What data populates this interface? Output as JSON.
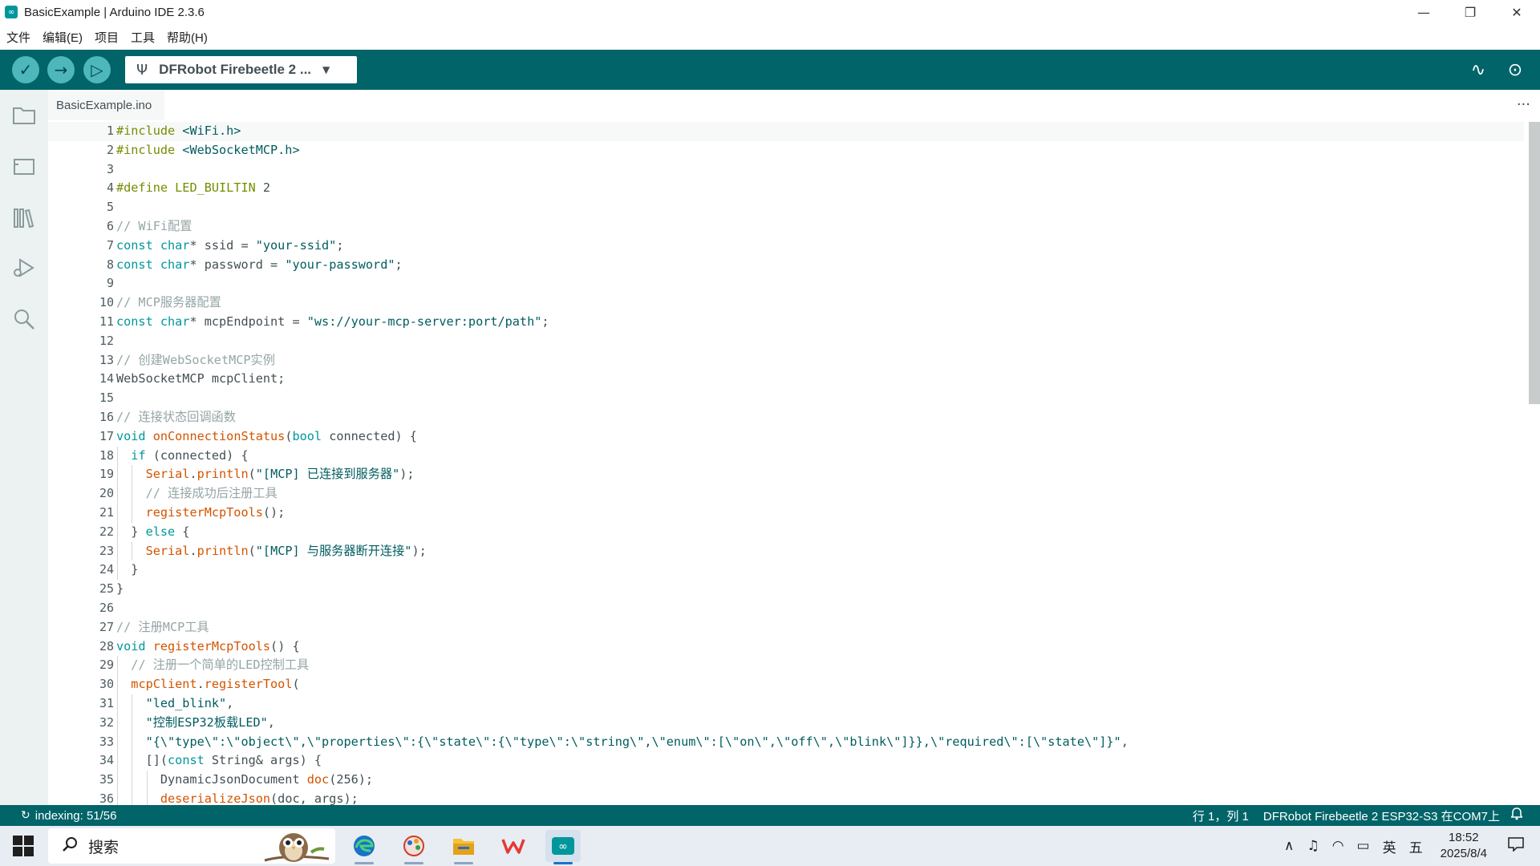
{
  "window": {
    "title": "BasicExample | Arduino IDE 2.3.6",
    "minimize": "—",
    "maximize": "❐",
    "close": "✕"
  },
  "menu": [
    "文件",
    "编辑(E)",
    "项目",
    "工具",
    "帮助(H)"
  ],
  "toolbar": {
    "verify_icon": "✓",
    "upload_icon": "→",
    "debug_icon": "▷",
    "board": "DFRobot Firebeetle 2 ...",
    "board_caret": "▼",
    "usb_icon": "Ψ",
    "plotter_icon": "∿",
    "monitor_icon": "⊙"
  },
  "sidebar_icons": [
    "folder-icon",
    "board-icon",
    "library-icon",
    "debug-icon",
    "search-icon"
  ],
  "tab": {
    "filename": "BasicExample.ino",
    "more": "···"
  },
  "colors": {
    "keyword": "#00979c",
    "type": "#00979c",
    "function": "#d35400",
    "string": "#005c5f",
    "comment": "#95a5a6",
    "directive": "#728e00",
    "plain": "#434f54",
    "toolbar": "#006468"
  },
  "code_lines": [
    {
      "n": "1",
      "indent": 0,
      "tokens": [
        [
          "#include",
          "directive"
        ],
        [
          " <WiFi.h>",
          "string"
        ]
      ]
    },
    {
      "n": "2",
      "indent": 0,
      "tokens": [
        [
          "#include",
          "directive"
        ],
        [
          " <WebSocketMCP.h>",
          "string"
        ]
      ]
    },
    {
      "n": "3",
      "indent": 0,
      "tokens": []
    },
    {
      "n": "4",
      "indent": 0,
      "tokens": [
        [
          "#define",
          "directive"
        ],
        [
          " LED_BUILTIN ",
          "directive"
        ],
        [
          "2",
          "plain"
        ]
      ]
    },
    {
      "n": "5",
      "indent": 0,
      "tokens": []
    },
    {
      "n": "6",
      "indent": 0,
      "tokens": [
        [
          "// WiFi配置",
          "comment"
        ]
      ]
    },
    {
      "n": "7",
      "indent": 0,
      "tokens": [
        [
          "const",
          "keyword"
        ],
        [
          " ",
          "plain"
        ],
        [
          "char",
          "type"
        ],
        [
          "* ssid = ",
          "plain"
        ],
        [
          "\"your-ssid\"",
          "string"
        ],
        [
          ";",
          "plain"
        ]
      ]
    },
    {
      "n": "8",
      "indent": 0,
      "tokens": [
        [
          "const",
          "keyword"
        ],
        [
          " ",
          "plain"
        ],
        [
          "char",
          "type"
        ],
        [
          "* password = ",
          "plain"
        ],
        [
          "\"your-password\"",
          "string"
        ],
        [
          ";",
          "plain"
        ]
      ]
    },
    {
      "n": "9",
      "indent": 0,
      "tokens": []
    },
    {
      "n": "10",
      "indent": 0,
      "tokens": [
        [
          "// MCP服务器配置",
          "comment"
        ]
      ]
    },
    {
      "n": "11",
      "indent": 0,
      "tokens": [
        [
          "const",
          "keyword"
        ],
        [
          " ",
          "plain"
        ],
        [
          "char",
          "type"
        ],
        [
          "* mcpEndpoint = ",
          "plain"
        ],
        [
          "\"ws://your-mcp-server:port/path\"",
          "string"
        ],
        [
          ";",
          "plain"
        ]
      ]
    },
    {
      "n": "12",
      "indent": 0,
      "tokens": []
    },
    {
      "n": "13",
      "indent": 0,
      "tokens": [
        [
          "// 创建WebSocketMCP实例",
          "comment"
        ]
      ]
    },
    {
      "n": "14",
      "indent": 0,
      "tokens": [
        [
          "WebSocketMCP mcpClient;",
          "plain"
        ]
      ]
    },
    {
      "n": "15",
      "indent": 0,
      "tokens": []
    },
    {
      "n": "16",
      "indent": 0,
      "tokens": [
        [
          "// 连接状态回调函数",
          "comment"
        ]
      ]
    },
    {
      "n": "17",
      "indent": 0,
      "tokens": [
        [
          "void",
          "keyword"
        ],
        [
          " ",
          "plain"
        ],
        [
          "onConnectionStatus",
          "function"
        ],
        [
          "(",
          "plain"
        ],
        [
          "bool",
          "type"
        ],
        [
          " connected) {",
          "plain"
        ]
      ]
    },
    {
      "n": "18",
      "indent": 1,
      "tokens": [
        [
          "  ",
          "plain"
        ],
        [
          "if",
          "keyword"
        ],
        [
          " (connected) {",
          "plain"
        ]
      ]
    },
    {
      "n": "19",
      "indent": 2,
      "tokens": [
        [
          "    ",
          "plain"
        ],
        [
          "Serial",
          "function"
        ],
        [
          ".",
          "plain"
        ],
        [
          "println",
          "function"
        ],
        [
          "(",
          "plain"
        ],
        [
          "\"[MCP] 已连接到服务器\"",
          "string"
        ],
        [
          ");",
          "plain"
        ]
      ]
    },
    {
      "n": "20",
      "indent": 2,
      "tokens": [
        [
          "    ",
          "plain"
        ],
        [
          "// 连接成功后注册工具",
          "comment"
        ]
      ]
    },
    {
      "n": "21",
      "indent": 2,
      "tokens": [
        [
          "    ",
          "plain"
        ],
        [
          "registerMcpTools",
          "function"
        ],
        [
          "();",
          "plain"
        ]
      ]
    },
    {
      "n": "22",
      "indent": 1,
      "tokens": [
        [
          "  } ",
          "plain"
        ],
        [
          "else",
          "keyword"
        ],
        [
          " {",
          "plain"
        ]
      ]
    },
    {
      "n": "23",
      "indent": 2,
      "tokens": [
        [
          "    ",
          "plain"
        ],
        [
          "Serial",
          "function"
        ],
        [
          ".",
          "plain"
        ],
        [
          "println",
          "function"
        ],
        [
          "(",
          "plain"
        ],
        [
          "\"[MCP] 与服务器断开连接\"",
          "string"
        ],
        [
          ");",
          "plain"
        ]
      ]
    },
    {
      "n": "24",
      "indent": 1,
      "tokens": [
        [
          "  }",
          "plain"
        ]
      ]
    },
    {
      "n": "25",
      "indent": 0,
      "tokens": [
        [
          "}",
          "plain"
        ]
      ]
    },
    {
      "n": "26",
      "indent": 0,
      "tokens": []
    },
    {
      "n": "27",
      "indent": 0,
      "tokens": [
        [
          "// 注册MCP工具",
          "comment"
        ]
      ]
    },
    {
      "n": "28",
      "indent": 0,
      "tokens": [
        [
          "void",
          "keyword"
        ],
        [
          " ",
          "plain"
        ],
        [
          "registerMcpTools",
          "function"
        ],
        [
          "() {",
          "plain"
        ]
      ]
    },
    {
      "n": "29",
      "indent": 1,
      "tokens": [
        [
          "  ",
          "plain"
        ],
        [
          "// 注册一个简单的LED控制工具",
          "comment"
        ]
      ]
    },
    {
      "n": "30",
      "indent": 1,
      "tokens": [
        [
          "  ",
          "plain"
        ],
        [
          "mcpClient",
          "function"
        ],
        [
          ".",
          "plain"
        ],
        [
          "registerTool",
          "function"
        ],
        [
          "(",
          "plain"
        ]
      ]
    },
    {
      "n": "31",
      "indent": 2,
      "tokens": [
        [
          "    ",
          "plain"
        ],
        [
          "\"led_blink\"",
          "string"
        ],
        [
          ",",
          "plain"
        ]
      ]
    },
    {
      "n": "32",
      "indent": 2,
      "tokens": [
        [
          "    ",
          "plain"
        ],
        [
          "\"控制ESP32板载LED\"",
          "string"
        ],
        [
          ",",
          "plain"
        ]
      ]
    },
    {
      "n": "33",
      "indent": 2,
      "tokens": [
        [
          "    ",
          "plain"
        ],
        [
          "\"{\\\"type\\\":\\\"object\\\",\\\"properties\\\":{\\\"state\\\":{\\\"type\\\":\\\"string\\\",\\\"enum\\\":[\\\"on\\\",\\\"off\\\",\\\"blink\\\"]}},\\\"required\\\":[\\\"state\\\"]}\"",
          "string"
        ],
        [
          ",",
          "plain"
        ]
      ]
    },
    {
      "n": "34",
      "indent": 2,
      "tokens": [
        [
          "    []",
          "plain"
        ],
        [
          "(",
          "plain"
        ],
        [
          "const",
          "keyword"
        ],
        [
          " String& args) {",
          "plain"
        ]
      ]
    },
    {
      "n": "35",
      "indent": 3,
      "tokens": [
        [
          "      DynamicJsonDocument ",
          "plain"
        ],
        [
          "doc",
          "function"
        ],
        [
          "(256);",
          "plain"
        ]
      ]
    },
    {
      "n": "36",
      "indent": 3,
      "tokens": [
        [
          "      ",
          "plain"
        ],
        [
          "deserializeJson",
          "function"
        ],
        [
          "(doc, args);",
          "plain"
        ]
      ]
    }
  ],
  "status": {
    "indexing": "indexing: 51/56",
    "position": "行 1，列 1",
    "board_port": "DFRobot Firebeetle 2 ESP32-S3 在COM7上",
    "sync_icon": "↻",
    "bell_icon": "♪"
  },
  "taskbar": {
    "search_placeholder": "搜索",
    "search_icon": "⌕",
    "apps": [
      {
        "name": "edge-icon",
        "color": "#1a73c8",
        "glyph": "e"
      },
      {
        "name": "paint-icon",
        "color": "#d23b2a",
        "glyph": "✿"
      },
      {
        "name": "explorer-icon",
        "color": "#e3a21a",
        "glyph": "▤"
      },
      {
        "name": "wps-icon",
        "color": "#e53935",
        "glyph": "W"
      },
      {
        "name": "arduino-icon",
        "color": "#00979c",
        "glyph": "∞"
      }
    ],
    "tray_chevron": "∧",
    "tray_volume": "♫",
    "tray_wifi": "◠",
    "tray_battery": "▭",
    "ime_lang": "英",
    "ime_mode": "五",
    "time": "18:52",
    "date": "2025/8/4",
    "notification_icon": "□"
  }
}
